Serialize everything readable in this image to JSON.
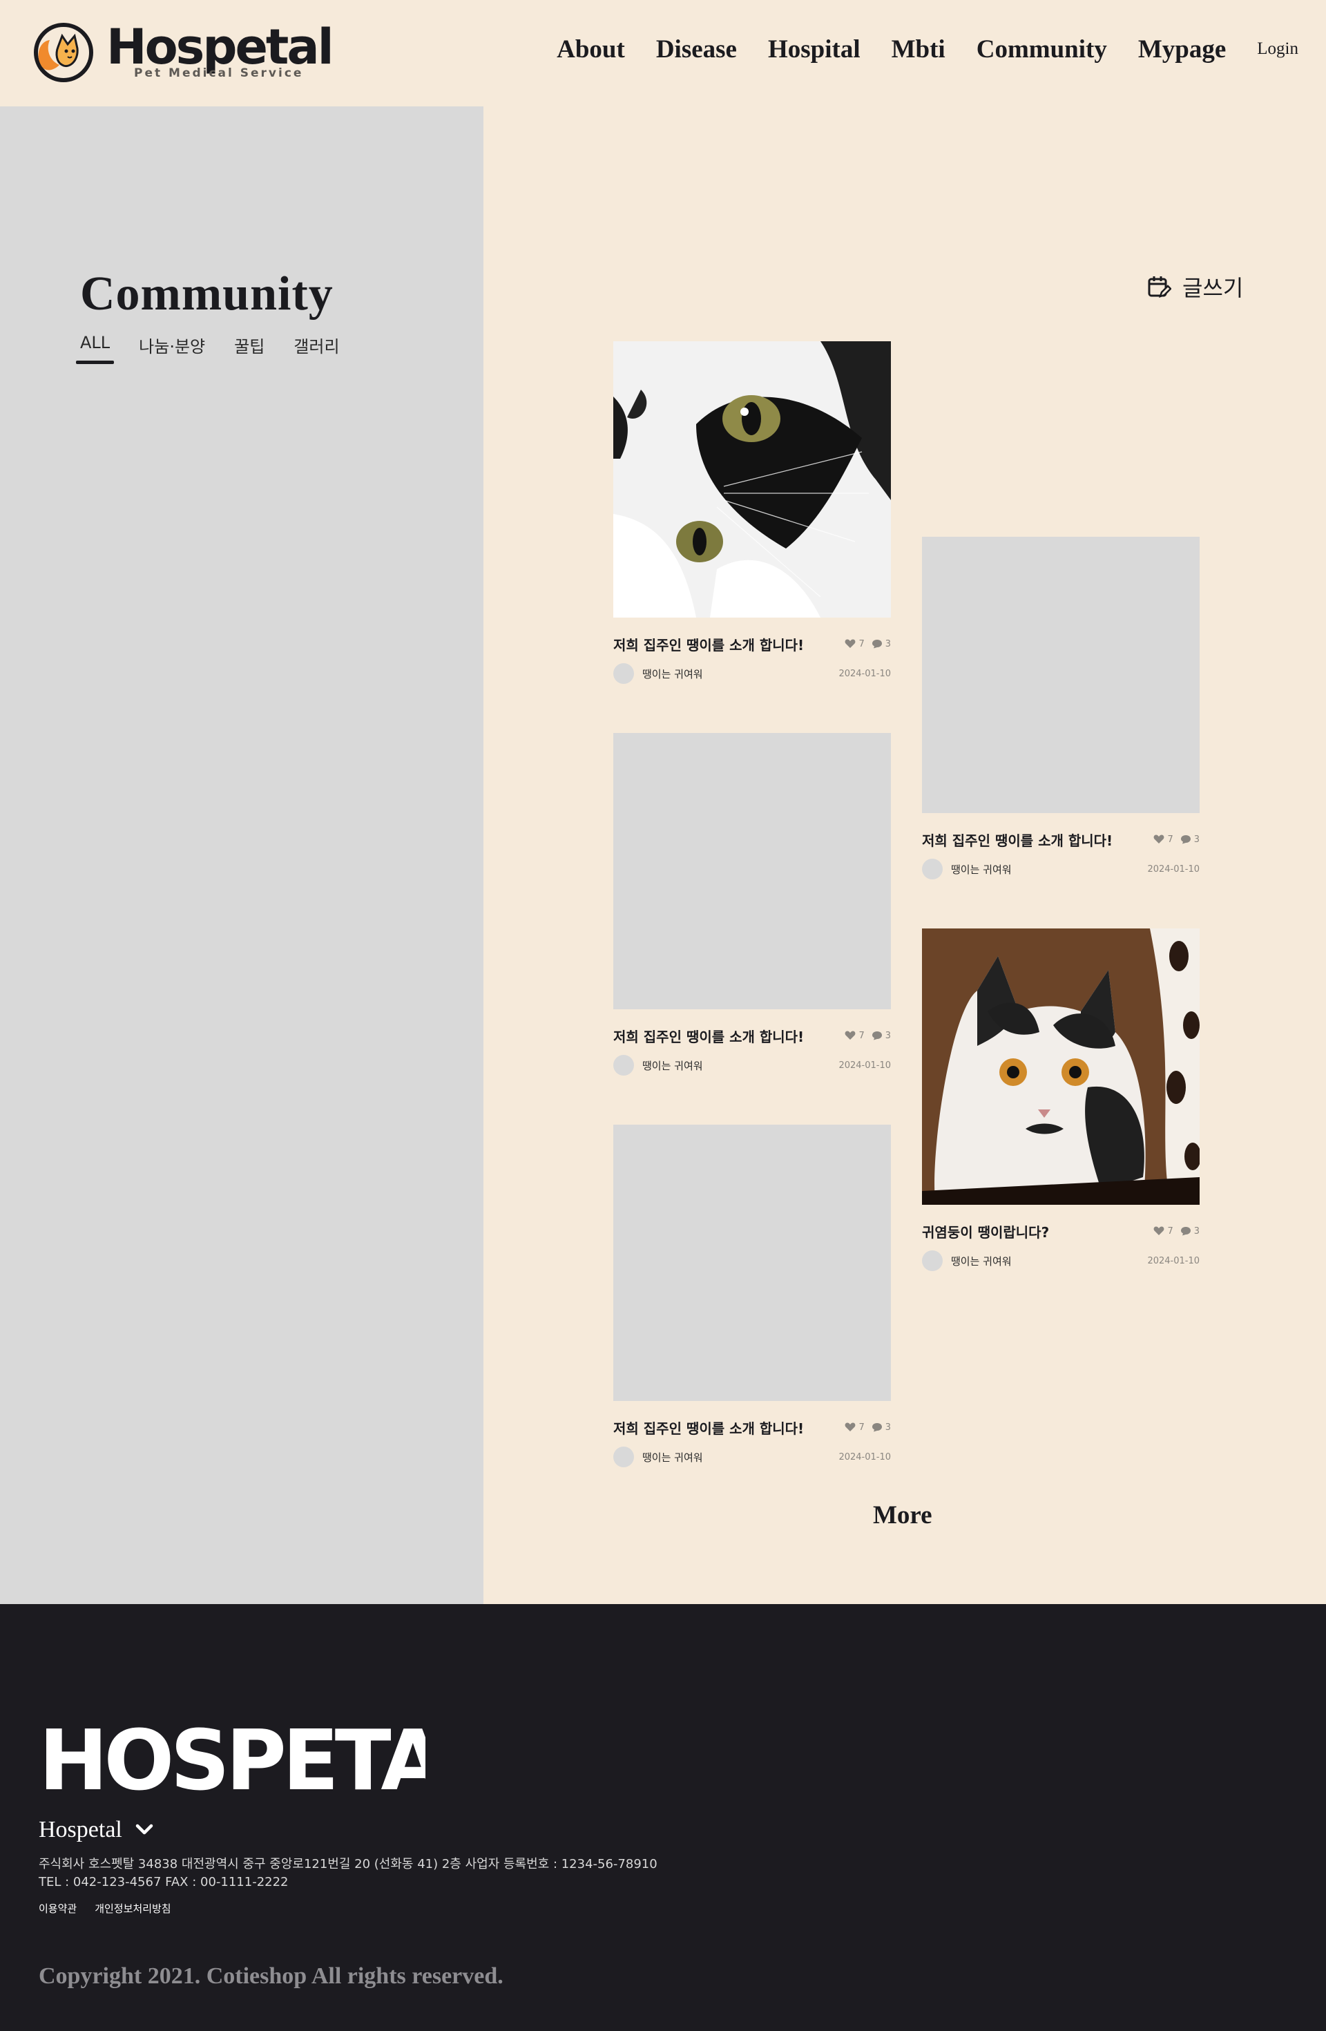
{
  "brand": {
    "name": "Hospetal",
    "tagline": "Pet Medical Service",
    "accent": "#f08a2d",
    "dark": "#1b1b1f",
    "background": "#f6eada"
  },
  "nav": {
    "items": [
      "About",
      "Disease",
      "Hospital",
      "Mbti",
      "Community",
      "Mypage"
    ],
    "login": "Login"
  },
  "sidebar": {
    "title": "Community",
    "tabs": [
      {
        "label": "ALL",
        "active": true
      },
      {
        "label": "나눔·분양",
        "active": false
      },
      {
        "label": "꿀팁",
        "active": false
      },
      {
        "label": "갤러리",
        "active": false
      }
    ]
  },
  "write_button": {
    "label": "글쓰기",
    "icon": "calendar-edit-icon"
  },
  "posts": [
    {
      "title": "저희 집주인 땡이를 소개 합니다!",
      "likes": "7",
      "comments": "3",
      "author": "땡이는 귀여워",
      "date": "2024-01-10",
      "image": "cat-closeup-photo"
    },
    {
      "title": "저희 집주인 땡이를 소개 합니다!",
      "likes": "7",
      "comments": "3",
      "author": "땡이는 귀여워",
      "date": "2024-01-10",
      "image": "placeholder"
    },
    {
      "title": "저희 집주인 땡이를 소개 합니다!",
      "likes": "7",
      "comments": "3",
      "author": "땡이는 귀여워",
      "date": "2024-01-10",
      "image": "placeholder"
    },
    {
      "title": "귀염둥이 땡이랍니다?",
      "likes": "7",
      "comments": "3",
      "author": "땡이는 귀여워",
      "date": "2024-01-10",
      "image": "cat-in-box-photo"
    },
    {
      "title": "저희 집주인 땡이를 소개 합니다!",
      "likes": "7",
      "comments": "3",
      "author": "땡이는 귀여워",
      "date": "2024-01-10",
      "image": "placeholder"
    }
  ],
  "more_label": "More",
  "footer": {
    "logo": "HOSPETAL",
    "company": "Hospetal",
    "address": "주식회사 호스펫탈 34838 대전광역시 중구 중앙로121번길 20 (선화동 41) 2층  사업자 등록번호 : 1234-56-78910",
    "contact": "TEL : 042-123-4567 FAX : 00-1111-2222",
    "links": [
      "이용약관",
      "개인정보처리방침"
    ],
    "copyright": "Copyright 2021. Cotieshop All rights reserved."
  }
}
